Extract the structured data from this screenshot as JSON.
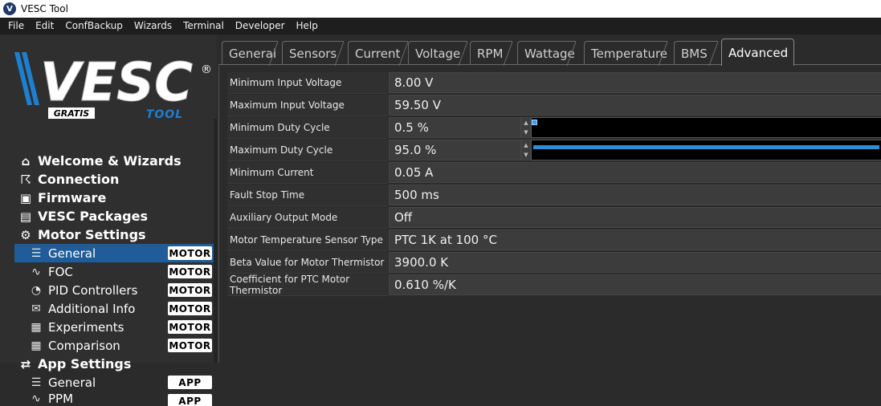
{
  "window": {
    "title": "VESC Tool",
    "icon": "vesc-app-icon"
  },
  "menu": [
    "File",
    "Edit",
    "ConfBackup",
    "Wizards",
    "Terminal",
    "Developer",
    "Help"
  ],
  "logo": {
    "main": "VESC",
    "sub1": "GRATIS",
    "sub2": "TOOL",
    "mark": "®"
  },
  "sidebar": {
    "items": [
      {
        "label": "Welcome & Wizards",
        "level": "top",
        "icon": "home-icon"
      },
      {
        "label": "Connection",
        "level": "top",
        "icon": "plug-icon"
      },
      {
        "label": "Firmware",
        "level": "top",
        "icon": "chip-icon"
      },
      {
        "label": "VESC Packages",
        "level": "top",
        "icon": "package-icon"
      },
      {
        "label": "Motor Settings",
        "level": "top",
        "icon": "motor-icon"
      },
      {
        "label": "General",
        "level": "sub",
        "icon": "sliders-icon",
        "badge": "MOTOR",
        "selected": true
      },
      {
        "label": "FOC",
        "level": "sub",
        "icon": "coil-icon",
        "badge": "MOTOR"
      },
      {
        "label": "PID Controllers",
        "level": "sub",
        "icon": "gauge-icon",
        "badge": "MOTOR"
      },
      {
        "label": "Additional Info",
        "level": "sub",
        "icon": "info-card-icon",
        "badge": "MOTOR"
      },
      {
        "label": "Experiments",
        "level": "sub",
        "icon": "calculator-icon",
        "badge": "MOTOR"
      },
      {
        "label": "Comparison",
        "level": "sub",
        "icon": "calculator-icon",
        "badge": "MOTOR"
      },
      {
        "label": "App Settings",
        "level": "top",
        "icon": "app-settings-icon"
      },
      {
        "label": "General",
        "level": "sub",
        "icon": "sliders-icon",
        "badge": "APP"
      },
      {
        "label": "PPM",
        "level": "sub",
        "icon": "wave-icon",
        "badge": "APP"
      }
    ]
  },
  "tabs": [
    "General",
    "Sensors",
    "Current",
    "Voltage",
    "RPM",
    "Wattage",
    "Temperature",
    "BMS",
    "Advanced"
  ],
  "active_tab": "Advanced",
  "params": [
    {
      "label": "Minimum Input Voltage",
      "value": "8.00 V"
    },
    {
      "label": "Maximum Input Voltage",
      "value": "59.50 V"
    },
    {
      "label": "Minimum Duty Cycle",
      "value": "0.5 %",
      "slider_fraction": 0.005
    },
    {
      "label": "Maximum Duty Cycle",
      "value": "95.0 %",
      "slider_fraction": 0.95
    },
    {
      "label": "Minimum Current",
      "value": "0.05 A"
    },
    {
      "label": "Fault Stop Time",
      "value": "500 ms"
    },
    {
      "label": "Auxiliary Output Mode",
      "value": "Off"
    },
    {
      "label": "Motor Temperature Sensor Type",
      "value": "PTC 1K at 100 °C"
    },
    {
      "label": "Beta Value for Motor Thermistor",
      "value": "3900.0 K"
    },
    {
      "label": "Coefficient for PTC Motor Thermistor",
      "value": "0.610 %/K"
    }
  ],
  "colors": {
    "accent": "#1f5c99",
    "slider": "#2a8ed8",
    "logo_blue": "#1e7fd0"
  }
}
